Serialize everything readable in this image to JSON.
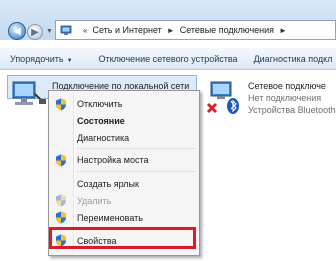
{
  "address_bar": {
    "crumbs": [
      "Сеть и Интернет",
      "Сетевые подключения"
    ],
    "icon": "network-folder-icon"
  },
  "toolbar": {
    "organize": "Упорядочить",
    "disable_device": "Отключение сетевого устройства",
    "diagnose": "Диагностика подкл"
  },
  "connections": [
    {
      "title": "Подключение по локальной сети",
      "icon": "network-adapter-icon"
    },
    {
      "title": "Сетевое подключе",
      "status": "Нет подключения",
      "device": "Устройства Bluetooth",
      "icon": "bluetooth-network-icon"
    }
  ],
  "context_menu": {
    "items": [
      {
        "label": "Отключить",
        "style": "normal",
        "icon": "shield-icon"
      },
      {
        "label": "Состояние",
        "style": "bold",
        "icon": ""
      },
      {
        "label": "Диагностика",
        "style": "normal",
        "icon": ""
      },
      {
        "label": "Настройка моста",
        "style": "normal",
        "icon": "shield-icon"
      },
      {
        "label": "Создать ярлык",
        "style": "normal",
        "icon": ""
      },
      {
        "label": "Удалить",
        "style": "disabled",
        "icon": "shield-icon"
      },
      {
        "label": "Переименовать",
        "style": "normal",
        "icon": "shield-icon"
      },
      {
        "label": "Свойства",
        "style": "normal",
        "icon": "shield-icon"
      }
    ],
    "highlight_color": "#e0182c"
  }
}
